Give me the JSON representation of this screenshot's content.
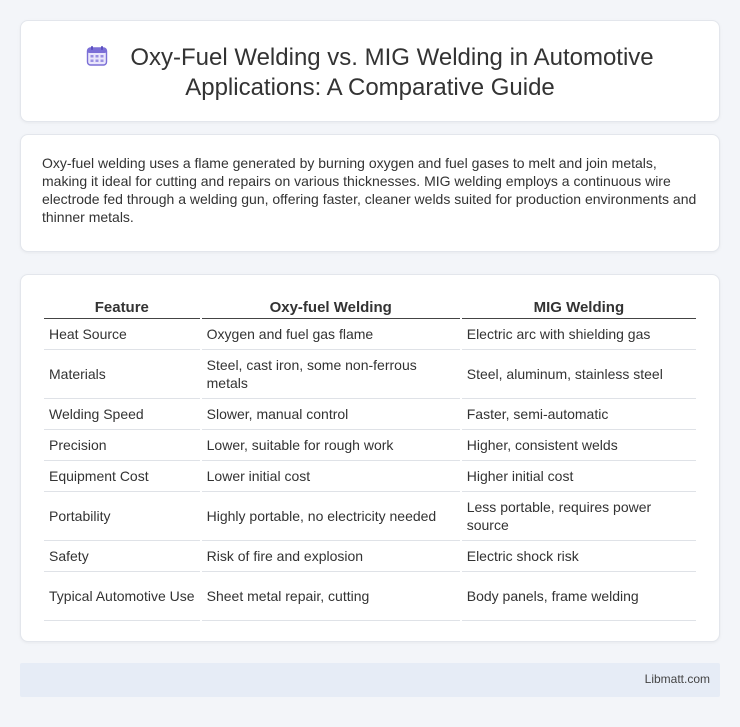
{
  "header": {
    "icon": "calendar-icon",
    "title": "Oxy-Fuel Welding vs. MIG Welding in Automotive Applications: A Comparative Guide"
  },
  "intro": {
    "text": "Oxy-fuel welding uses a flame generated by burning oxygen and fuel gases to melt and join metals, making it ideal for cutting and repairs on various thicknesses. MIG welding employs a continuous wire electrode fed through a welding gun, offering faster, cleaner welds suited for production environments and thinner metals."
  },
  "table": {
    "headers": [
      "Feature",
      "Oxy-fuel Welding",
      "MIG Welding"
    ],
    "rows": [
      [
        "Heat Source",
        "Oxygen and fuel gas flame",
        "Electric arc with shielding gas"
      ],
      [
        "Materials",
        "Steel, cast iron, some non-ferrous metals",
        "Steel, aluminum, stainless steel"
      ],
      [
        "Welding Speed",
        "Slower, manual control",
        "Faster, semi-automatic"
      ],
      [
        "Precision",
        "Lower, suitable for rough work",
        "Higher, consistent welds"
      ],
      [
        "Equipment Cost",
        "Lower initial cost",
        "Higher initial cost"
      ],
      [
        "Portability",
        "Highly portable, no electricity needed",
        "Less portable, requires power source"
      ],
      [
        "Safety",
        "Risk of fire and explosion",
        "Electric shock risk"
      ],
      [
        "Typical Automotive Use",
        "Sheet metal repair, cutting",
        "Body panels, frame welding"
      ]
    ]
  },
  "footer": {
    "brand": "Libmatt.com"
  },
  "colors": {
    "background": "#f3f5f9",
    "card": "#ffffff",
    "footer": "#e6ecf6",
    "icon_accent": "#7b6fd6"
  }
}
